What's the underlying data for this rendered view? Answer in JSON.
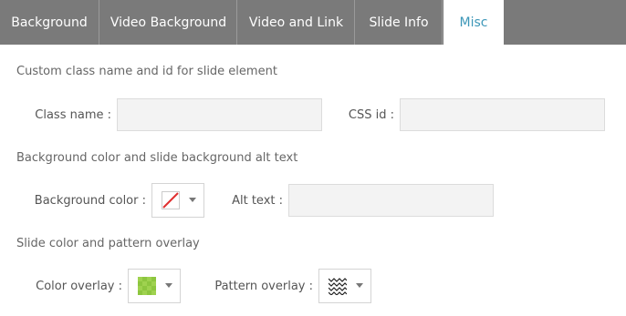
{
  "tabs": [
    {
      "label": "Background"
    },
    {
      "label": "Video Background"
    },
    {
      "label": "Video and Link"
    },
    {
      "label": "Slide Info"
    },
    {
      "label": "Misc",
      "active": true
    }
  ],
  "sections": {
    "custom_class": {
      "title": "Custom class name and id for slide element",
      "class_name_label": "Class name :",
      "class_name_value": "",
      "css_id_label": "CSS id :",
      "css_id_value": ""
    },
    "background": {
      "title": "Background color and slide background alt text",
      "bg_color_label": "Background color :",
      "bg_color_state": "none",
      "alt_text_label": "Alt text :",
      "alt_text_value": ""
    },
    "overlay": {
      "title": "Slide color and pattern overlay",
      "color_overlay_label": "Color overlay :",
      "color_overlay_color": "#8dc63f",
      "pattern_overlay_label": "Pattern overlay :",
      "pattern_overlay_icon": "zigzag-pattern"
    }
  },
  "colors": {
    "tabbar_bg": "#7a7a7a",
    "active_tab_text": "#3d97b8",
    "input_bg": "#f3f3f3"
  }
}
